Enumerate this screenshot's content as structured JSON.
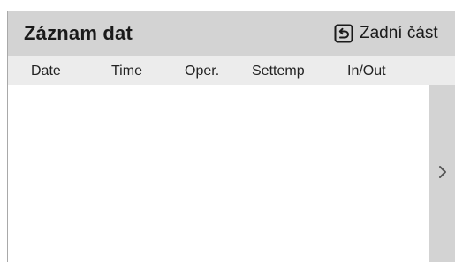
{
  "header": {
    "title": "Záznam dat",
    "back_label": "Zadní část",
    "back_icon": "back-arrow-icon"
  },
  "table": {
    "columns": [
      "Date",
      "Time",
      "Oper.",
      "Settemp",
      "In/Out"
    ],
    "rows": []
  },
  "scroll": {
    "next_icon": "chevron-right-icon"
  },
  "colors": {
    "header_bg": "#d3d3d3",
    "column_header_bg": "#ececec",
    "scrollbar_bg": "#d3d3d3",
    "text": "#1a1a1a"
  }
}
